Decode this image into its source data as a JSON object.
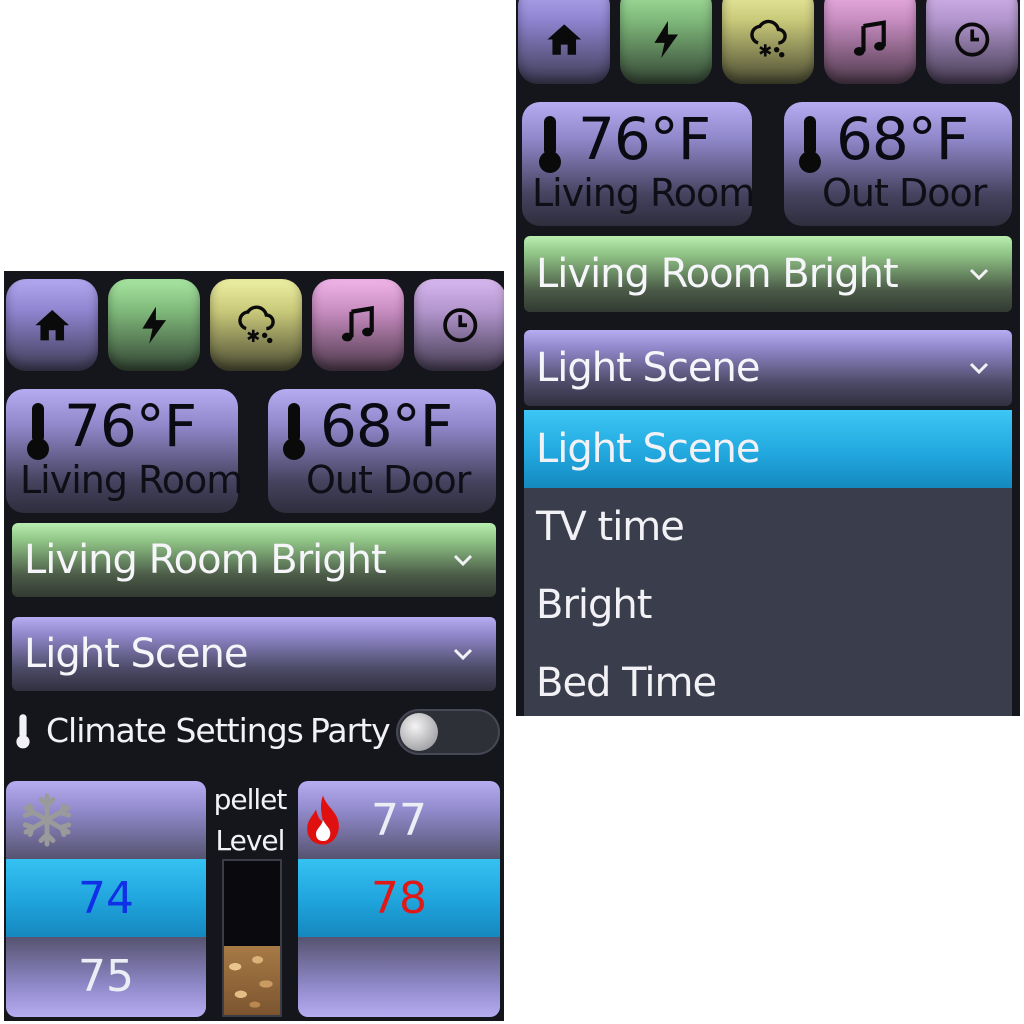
{
  "nav": {
    "buttons": [
      {
        "name": "home",
        "icon": "home-icon"
      },
      {
        "name": "power",
        "icon": "lightning-icon"
      },
      {
        "name": "climate",
        "icon": "snow-cloud-icon"
      },
      {
        "name": "music",
        "icon": "music-note-icon"
      },
      {
        "name": "schedule",
        "icon": "clock-icon"
      }
    ]
  },
  "temps": {
    "living_room": {
      "value": "76°F",
      "label": "Living Room"
    },
    "out_door": {
      "value": "68°F",
      "label": "Out Door"
    }
  },
  "scene_dropdown": {
    "value": "Living Room Bright"
  },
  "light_scene_dropdown": {
    "value": "Light Scene",
    "options": [
      "Light Scene",
      "TV time",
      "Bright",
      "Bed Time"
    ],
    "selected_index": 0
  },
  "climate": {
    "label": "Climate Settings",
    "party_label": "Party",
    "party_on": false
  },
  "cooling": {
    "icon": "snowflake-icon",
    "values": [
      "",
      "74",
      "75"
    ],
    "selected_index": 1,
    "selected_color": "#1030e8"
  },
  "heating": {
    "icon": "flame-icon",
    "values": [
      "77",
      "78",
      ""
    ],
    "selected_index": 1,
    "selected_color": "#e01818"
  },
  "pellet": {
    "label_line1": "pellet",
    "label_line2": "Level",
    "level_fraction": 0.45
  },
  "colors": {
    "selected_blue": "#22a8df",
    "panel_purple": "#8f88c8",
    "background": "#14161c"
  }
}
